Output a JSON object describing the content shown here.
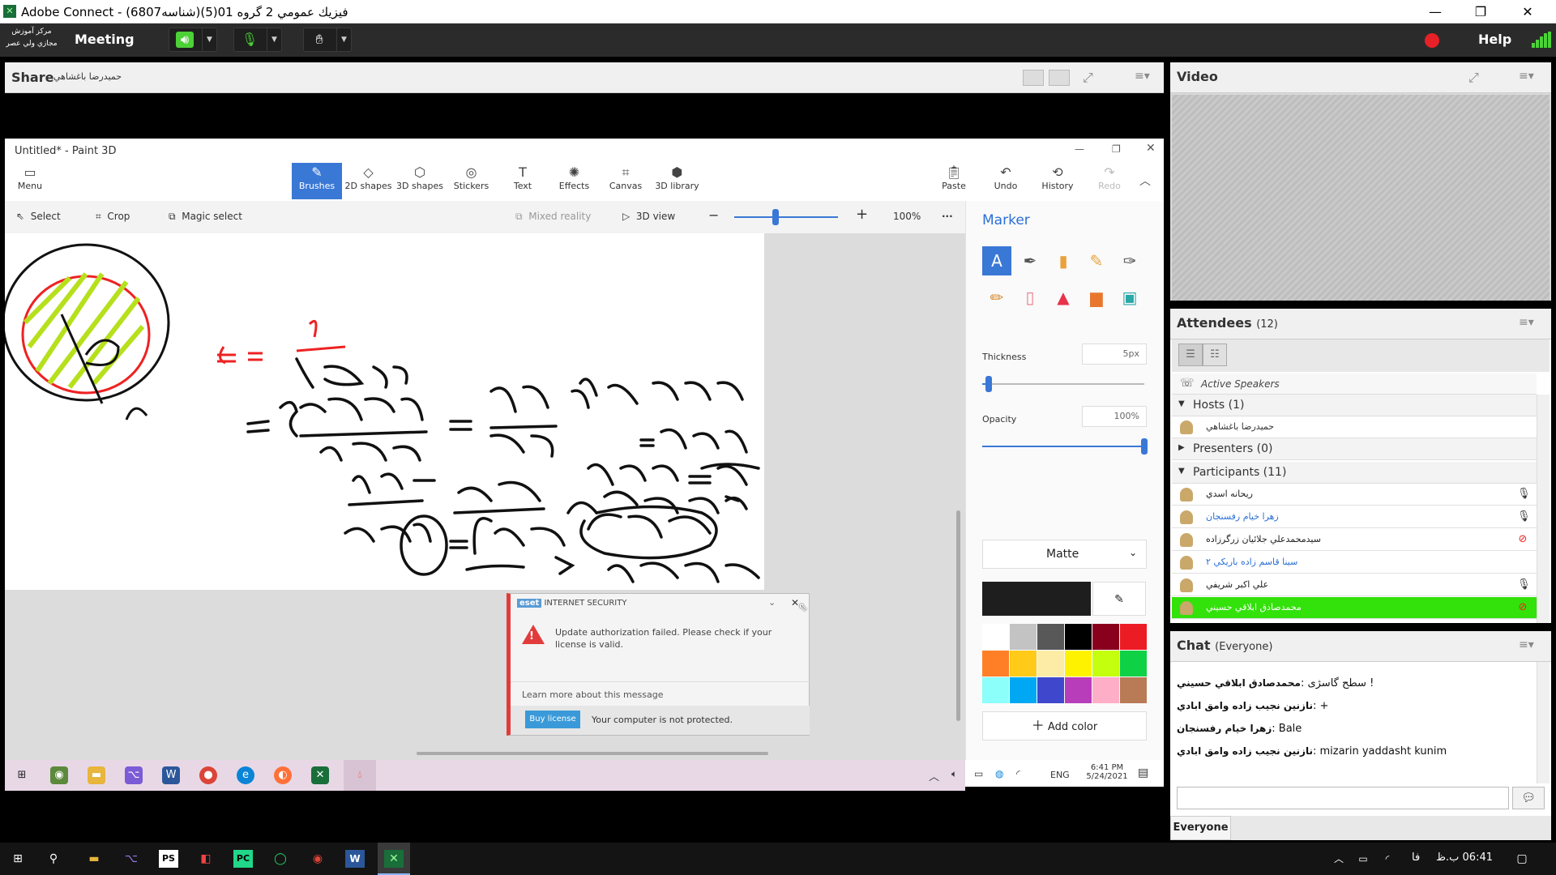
{
  "window": {
    "title": "Adobe Connect - فيزيك عمومي 2 گروه 01(5)(شناسه6807)",
    "minimize_icon": "minimize-icon",
    "maximize_icon": "restore-icon",
    "close_icon": "close-icon"
  },
  "meeting_bar": {
    "logo_line1": "مركز آموزش",
    "logo_line2": "مجازي ولي عصر",
    "meeting_label": "Meeting",
    "help_label": "Help",
    "speaker_icon": "speaker-icon",
    "mic_icon": "microphone-muted-icon",
    "raise_hand_icon": "raise-hand-icon",
    "record_icon": "record-icon",
    "signal_icon": "connection-signal-icon",
    "colors": {
      "bar": "#2b2b2b",
      "speaker_active": "#4cd137",
      "record": "#e82027"
    }
  },
  "share_pod": {
    "title": "Share",
    "presenter": "حميدرضا باغشاهي"
  },
  "paint3d": {
    "title": "Untitled* - Paint 3D",
    "menu_label": "Menu",
    "tools": [
      {
        "label": "Brushes",
        "icon": "brush-icon"
      },
      {
        "label": "2D shapes",
        "icon": "2d-shapes-icon"
      },
      {
        "label": "3D shapes",
        "icon": "3d-shapes-icon"
      },
      {
        "label": "Stickers",
        "icon": "sticker-icon"
      },
      {
        "label": "Text",
        "icon": "text-icon"
      },
      {
        "label": "Effects",
        "icon": "effects-icon"
      },
      {
        "label": "Canvas",
        "icon": "canvas-icon"
      },
      {
        "label": "3D library",
        "icon": "3d-library-icon"
      }
    ],
    "right_tools": [
      {
        "label": "Paste",
        "icon": "paste-icon"
      },
      {
        "label": "Undo",
        "icon": "undo-icon"
      },
      {
        "label": "History",
        "icon": "history-icon"
      },
      {
        "label": "Redo",
        "icon": "redo-icon"
      }
    ],
    "sub_toolbar": {
      "select": "Select",
      "crop": "Crop",
      "magic_select": "Magic select",
      "mixed_reality": "Mixed reality",
      "view_3d": "3D view",
      "zoom": "100%",
      "zoom_level": 0.4
    },
    "side_panel": {
      "title": "Marker",
      "thickness_label": "Thickness",
      "thickness_value": "5px",
      "thickness_level": 0.04,
      "opacity_label": "Opacity",
      "opacity_value": "100%",
      "opacity_level": 1.0,
      "finish": "Matte",
      "add_color": "Add color",
      "current_color": "#1e1e1e",
      "palette": [
        "#ffffff",
        "#c3c3c3",
        "#585858",
        "#000000",
        "#88001b",
        "#ec1c24",
        "#ff7f27",
        "#ffca18",
        "#fdeca6",
        "#fff200",
        "#c4ff0e",
        "#0ed145",
        "#8cfffb",
        "#00a8f3",
        "#3f48cc",
        "#b83dba",
        "#ffaec8",
        "#b97a56"
      ]
    }
  },
  "eset_popup": {
    "brand": "INTERNET SECURITY",
    "message": "Update authorization failed. Please check if your license is valid.",
    "learn_more": "Learn more about this message",
    "buy_button": "Buy license",
    "status": "Your computer is not protected."
  },
  "shared_taskbar": {
    "lang": "ENG",
    "time": "6:41 PM",
    "date": "5/24/2021"
  },
  "video_pod": {
    "title": "Video"
  },
  "attendees_pod": {
    "title": "Attendees",
    "count": "(12)",
    "active_speakers": "Active Speakers",
    "hosts_label": "Hosts (1)",
    "presenters_label": "Presenters (0)",
    "participants_label": "Participants (11)",
    "hosts": [
      "حميدرضا باغشاهي"
    ],
    "participants": [
      {
        "name": "ريحانه اسدي",
        "color": "#222222",
        "mic": "mic-icon",
        "highlight": false
      },
      {
        "name": "زهرا خيام رفسنجان",
        "color": "#2a6fd6",
        "mic": "mic-icon",
        "highlight": false
      },
      {
        "name": "سيدمحمدعلي جلائيان زرگرزاده",
        "color": "#222222",
        "mic": "mic-off-icon",
        "highlight": false
      },
      {
        "name": "سينا قاسم زاده باريكي ۲",
        "color": "#2a6fd6",
        "mic": "",
        "highlight": false
      },
      {
        "name": "علي اكبر شريفي",
        "color": "#222222",
        "mic": "mic-icon",
        "highlight": false
      },
      {
        "name": "محمدصادق ابلاقي حسيني",
        "color": "#ffffff",
        "mic": "mic-off-icon",
        "highlight": true
      }
    ]
  },
  "chat_pod": {
    "title": "Chat",
    "scope": "(Everyone)",
    "messages": [
      {
        "from": "محمدصادق ابلاقي حسيني",
        "text": "سطح گاسژی !"
      },
      {
        "from": "نازنین نجیب زاده وامق ابادي",
        "text": "+"
      },
      {
        "from": "زهرا خيام رفسنجان",
        "text": "Bale"
      },
      {
        "from": "نازنین نجیب زاده وامق ابادي",
        "text": "mizarin yaddasht kunim"
      }
    ],
    "footer_tab": "Everyone",
    "send_icon": "send-icon"
  },
  "host_taskbar": {
    "lang": "فا",
    "time": "06:41 ب.ظ"
  }
}
